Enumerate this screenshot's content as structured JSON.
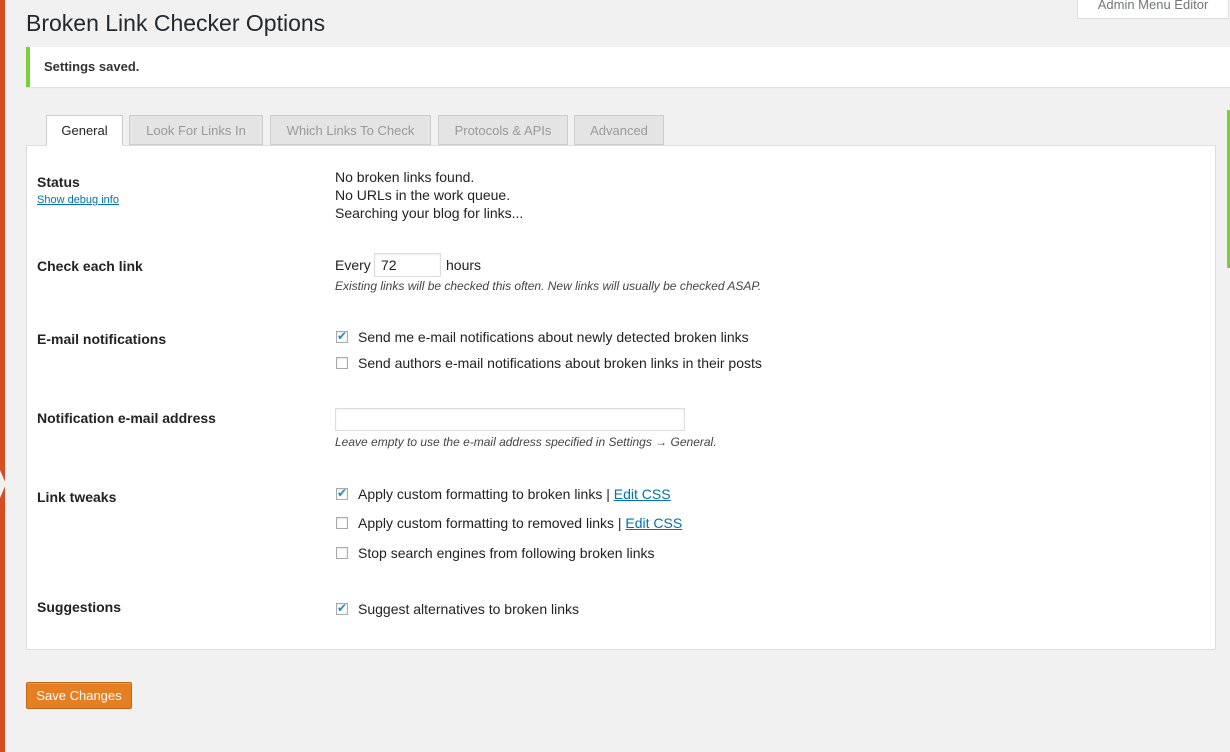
{
  "page": {
    "title": "Broken Link Checker Options",
    "screen_meta_tab": "Admin Menu Editor"
  },
  "notice": {
    "text": "Settings saved.",
    "color": "#7ad03a"
  },
  "tabs": [
    {
      "label": "General",
      "active": true
    },
    {
      "label": "Look For Links In",
      "active": false
    },
    {
      "label": "Which Links To Check",
      "active": false
    },
    {
      "label": "Protocols & APIs",
      "active": false
    },
    {
      "label": "Advanced",
      "active": false
    }
  ],
  "status": {
    "label": "Status",
    "debug_link": "Show debug info",
    "lines": [
      "No broken links found.",
      "No URLs in the work queue.",
      "Searching your blog for links..."
    ]
  },
  "check_each_link": {
    "label": "Check each link",
    "prefix": "Every",
    "value": "72",
    "suffix": "hours",
    "note": "Existing links will be checked this often. New links will usually be checked ASAP."
  },
  "email_notifications": {
    "label": "E-mail notifications",
    "options": [
      {
        "label": "Send me e-mail notifications about newly detected broken links",
        "checked": true
      },
      {
        "label": "Send authors e-mail notifications about broken links in their posts",
        "checked": false
      }
    ]
  },
  "notification_email": {
    "label": "Notification e-mail address",
    "value": "",
    "note": "Leave empty to use the e-mail address specified in Settings → General."
  },
  "link_tweaks": {
    "label": "Link tweaks",
    "options": [
      {
        "label": "Apply custom formatting to broken links",
        "checked": true,
        "edit_link": "Edit CSS"
      },
      {
        "label": "Apply custom formatting to removed links",
        "checked": false,
        "edit_link": "Edit CSS"
      },
      {
        "label": "Stop search engines from following broken links",
        "checked": false
      }
    ],
    "separator": "|"
  },
  "suggestions": {
    "label": "Suggestions",
    "options": [
      {
        "label": "Suggest alternatives to broken links",
        "checked": true
      }
    ]
  },
  "actions": {
    "save_label": "Save Changes",
    "accent": "#e67e22"
  }
}
